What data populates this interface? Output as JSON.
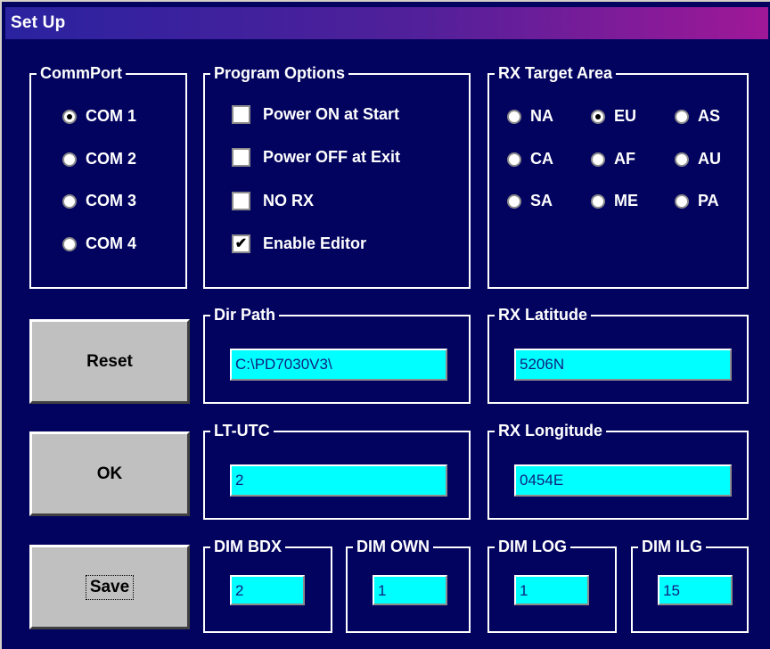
{
  "window": {
    "title": "Set Up"
  },
  "commport": {
    "label": "CommPort",
    "options": [
      {
        "label": "COM 1",
        "selected": true
      },
      {
        "label": "COM 2",
        "selected": false
      },
      {
        "label": "COM 3",
        "selected": false
      },
      {
        "label": "COM 4",
        "selected": false
      }
    ]
  },
  "program_options": {
    "label": "Program Options",
    "items": [
      {
        "label": "Power ON at Start",
        "checked": false
      },
      {
        "label": "Power OFF at Exit",
        "checked": false
      },
      {
        "label": "NO RX",
        "checked": false
      },
      {
        "label": "Enable Editor",
        "checked": true
      }
    ]
  },
  "rx_target_area": {
    "label": "RX Target Area",
    "options": [
      {
        "label": "NA",
        "selected": false
      },
      {
        "label": "EU",
        "selected": true
      },
      {
        "label": "AS",
        "selected": false
      },
      {
        "label": "CA",
        "selected": false
      },
      {
        "label": "AF",
        "selected": false
      },
      {
        "label": "AU",
        "selected": false
      },
      {
        "label": "SA",
        "selected": false
      },
      {
        "label": "ME",
        "selected": false
      },
      {
        "label": "PA",
        "selected": false
      }
    ]
  },
  "dir_path": {
    "label": "Dir Path",
    "value": "C:\\PD7030V3\\"
  },
  "rx_latitude": {
    "label": "RX Latitude",
    "value": "5206N"
  },
  "lt_utc": {
    "label": "LT-UTC",
    "value": "2"
  },
  "rx_longitude": {
    "label": "RX Longitude",
    "value": "0454E"
  },
  "dim_bdx": {
    "label": "DIM BDX",
    "value": "2"
  },
  "dim_own": {
    "label": "DIM OWN",
    "value": "1"
  },
  "dim_log": {
    "label": "DIM LOG",
    "value": "1"
  },
  "dim_ilg": {
    "label": "DIM ILG",
    "value": "15"
  },
  "buttons": {
    "reset": "Reset",
    "ok": "OK",
    "save": "Save"
  },
  "colors": {
    "background": "#02035f",
    "field": "#00ffff",
    "button": "#c0c0c0",
    "title_start": "#2a22a0",
    "title_end": "#a01898"
  }
}
